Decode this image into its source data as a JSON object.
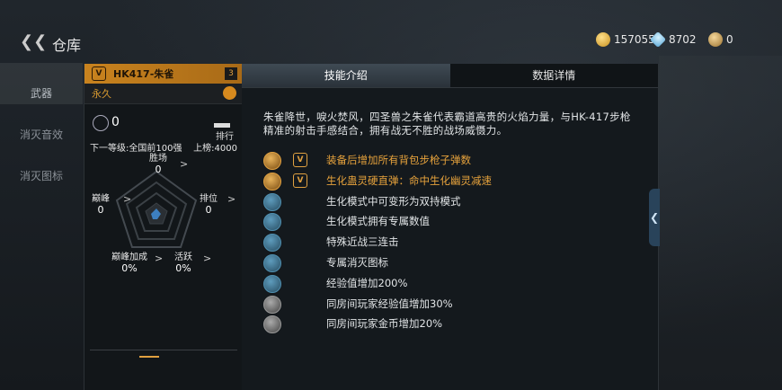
{
  "header": {
    "back_icon": "back-chevron-icon",
    "title": "仓库",
    "gold": "157055",
    "diamonds": "8702",
    "medals": "0"
  },
  "sidenav": {
    "items": [
      {
        "label": "武器",
        "active": true
      },
      {
        "label": "消灭音效",
        "active": false
      },
      {
        "label": "消灭图标",
        "active": false
      }
    ]
  },
  "weapon": {
    "badge": "V",
    "name": "HK417-朱雀",
    "level": "3",
    "duration": "永久",
    "kills": "0",
    "rank_label": "排行",
    "next_level": "下一等级:全国前100强",
    "rank_value": "上榜:4000"
  },
  "radar": {
    "wins": {
      "label": "胜场",
      "value": "0"
    },
    "peak": {
      "label": "巅峰",
      "value": "0"
    },
    "ranking": {
      "label": "排位",
      "value": "0"
    },
    "peak_bonus": {
      "label": "巅峰加成",
      "value": "0%"
    },
    "activity": {
      "label": "活跃",
      "value": "0%"
    }
  },
  "tabs": [
    {
      "label": "技能介绍",
      "active": true
    },
    {
      "label": "数据详情",
      "active": false
    }
  ],
  "description": "朱雀降世，唳火焚风，四圣兽之朱雀代表霸道高贵的火焰力量，与HK-417步枪精准的射击手感结合，拥有战无不胜的战场威慑力。",
  "skills": [
    {
      "text": "装备后增加所有背包步枪子弹数",
      "style": "gold",
      "icon": "rifle-icon",
      "vip": "V"
    },
    {
      "text": "生化蛊灵硬直弹：命中生化幽灵减速",
      "style": "gold",
      "icon": "bullet-icon",
      "vip": "V"
    },
    {
      "text": "生化模式中可变形为双持模式",
      "style": "blue",
      "icon": "transform-icon",
      "vip": ""
    },
    {
      "text": "生化模式拥有专属数值",
      "style": "blue",
      "icon": "stats-icon",
      "vip": ""
    },
    {
      "text": "特殊近战三连击",
      "style": "blue",
      "icon": "melee-icon",
      "vip": ""
    },
    {
      "text": "专属消灭图标",
      "style": "blue",
      "icon": "kill-mark-icon",
      "vip": ""
    },
    {
      "text": "经验值增加200%",
      "style": "blue",
      "icon": "exp-icon",
      "vip": ""
    },
    {
      "text": "同房间玩家经验值增加30%",
      "style": "gray",
      "icon": "exp-room-icon",
      "vip": ""
    },
    {
      "text": "同房间玩家金币增加20%",
      "style": "gray",
      "icon": "coin-room-icon",
      "vip": ""
    }
  ],
  "colors": {
    "accent": "#e0a040",
    "skill_blue": "#4f8fb0"
  }
}
